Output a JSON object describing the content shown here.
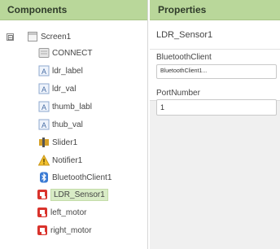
{
  "components": {
    "header": "Components",
    "items": [
      {
        "label": "Screen1",
        "icon": "screen-icon"
      },
      {
        "label": "CONNECT",
        "icon": "button-icon"
      },
      {
        "label": "ldr_label",
        "icon": "label-icon"
      },
      {
        "label": "ldr_val",
        "icon": "label-icon"
      },
      {
        "label": "thumb_labl",
        "icon": "label-icon"
      },
      {
        "label": "thub_val",
        "icon": "label-icon"
      },
      {
        "label": "Slider1",
        "icon": "slider-icon"
      },
      {
        "label": "Notifier1",
        "icon": "notifier-icon"
      },
      {
        "label": "BluetoothClient1",
        "icon": "bluetooth-icon"
      },
      {
        "label": "LDR_Sensor1",
        "icon": "extension-icon"
      },
      {
        "label": "left_motor",
        "icon": "extension-icon"
      },
      {
        "label": "right_motor",
        "icon": "extension-icon"
      }
    ],
    "toggle": "⊟",
    "selected": "LDR_Sensor1"
  },
  "properties": {
    "header": "Properties",
    "component_name": "LDR_Sensor1",
    "bluetooth_label": "BluetoothClient",
    "bluetooth_value": "BluetoothClient1...",
    "port_label": "PortNumber",
    "port_value": "1"
  },
  "colors": {
    "header_bg": "#b9d79a",
    "selection_bg": "#d9ecc6",
    "extension_red": "#d9332c"
  }
}
